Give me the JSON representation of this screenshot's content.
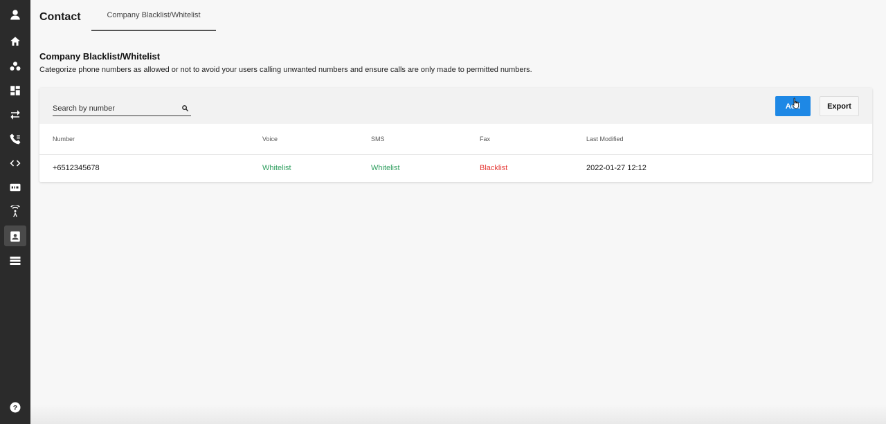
{
  "header": {
    "title": "Contact",
    "tab_label": "Company Blacklist/Whitelist"
  },
  "section": {
    "title": "Company Blacklist/Whitelist",
    "description": "Categorize phone numbers as allowed or not to avoid your users calling unwanted numbers and ensure calls are only made to permitted numbers."
  },
  "toolbar": {
    "search_placeholder": "Search by number",
    "add_label": "Add",
    "export_label": "Export"
  },
  "table": {
    "columns": [
      "Number",
      "Voice",
      "SMS",
      "Fax",
      "Last Modified"
    ],
    "rows": [
      {
        "number": "+6512345678",
        "voice": "Whitelist",
        "sms": "Whitelist",
        "fax": "Blacklist",
        "last_modified": "2022-01-27 12:12"
      }
    ]
  },
  "sidebar": {
    "icons": [
      "user-avatar-icon",
      "home-icon",
      "groups-icon",
      "dashboard-icon",
      "transfer-icon",
      "call-flow-icon",
      "code-icon",
      "sip-icon",
      "broadcast-icon",
      "contact-card-icon",
      "list-icon",
      "help-icon"
    ],
    "active": "contact-card-icon"
  },
  "colors": {
    "accent": "#1e88e5",
    "whitelist": "#2e9e5e",
    "blacklist": "#e53935",
    "sidebar": "#2b2b2b"
  }
}
